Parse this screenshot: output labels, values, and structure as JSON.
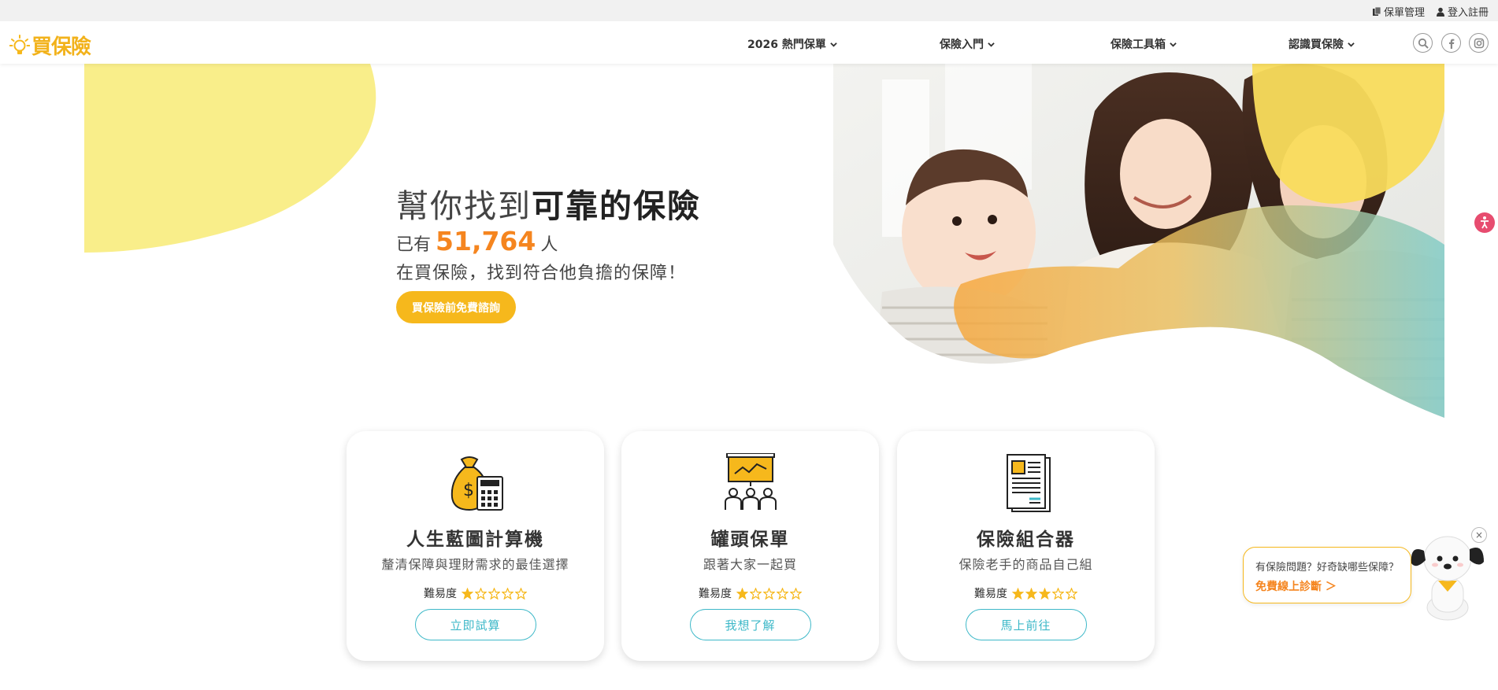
{
  "topbar": {
    "policy_manage": "保單管理",
    "login": "登入註冊"
  },
  "brand": {
    "logo_text": "買保險",
    "primary_color": "#f6b81c",
    "accent_color": "#f5851f",
    "teal_color": "#3db8c8"
  },
  "nav": {
    "items": [
      {
        "label": "2026 熱門保單",
        "icon": "chevron-down-icon"
      },
      {
        "label": "保險入門",
        "icon": "chevron-down-icon"
      },
      {
        "label": "保險工具箱",
        "icon": "chevron-down-icon"
      },
      {
        "label": "認識買保險",
        "icon": "chevron-down-icon"
      }
    ],
    "icons": [
      "search-icon",
      "facebook-icon",
      "instagram-icon"
    ]
  },
  "hero": {
    "title_light": "幫你找到",
    "title_bold": "可靠的保險",
    "count_prefix": "已有",
    "count_value": "51,764",
    "count_suffix": "人",
    "subtitle": "在買保險，找到符合他負擔的保障！",
    "cta_label": "買保險前免費諮詢"
  },
  "cards": [
    {
      "icon": "money-bag-calculator-icon",
      "title": "人生藍圖計算機",
      "desc": "釐清保障與理財需求的最佳選擇",
      "difficulty_label": "難易度",
      "stars": 1,
      "max_stars": 5,
      "button": "立即試算"
    },
    {
      "icon": "presentation-audience-icon",
      "title": "罐頭保單",
      "desc": "跟著大家一起買",
      "difficulty_label": "難易度",
      "stars": 1,
      "max_stars": 5,
      "button": "我想了解"
    },
    {
      "icon": "document-icon",
      "title": "保險組合器",
      "desc": "保險老手的商品自己組",
      "difficulty_label": "難易度",
      "stars": 3,
      "max_stars": 5,
      "button": "馬上前往"
    }
  ],
  "chat": {
    "question": "有保險問題？好奇缺哪些保障？",
    "link": "免費線上診斷 ＞",
    "close": "×"
  }
}
